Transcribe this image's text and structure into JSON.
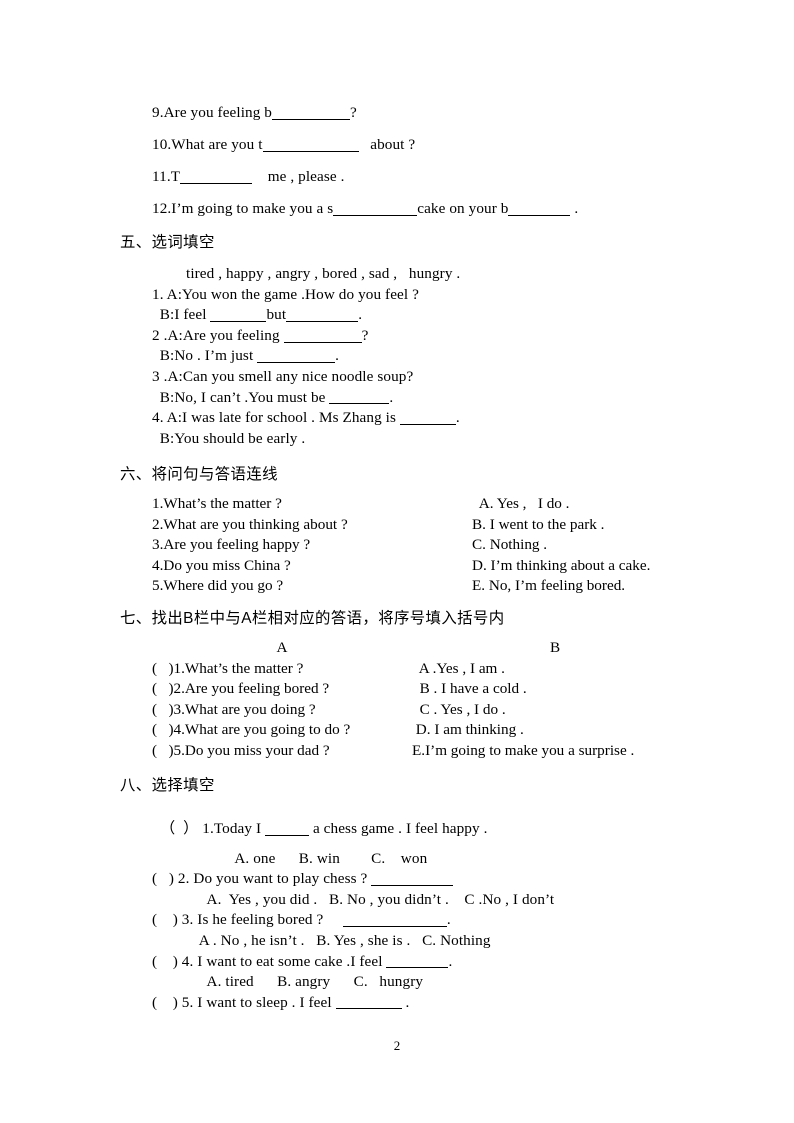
{
  "document": {
    "page_number": "2",
    "language": "English exercise worksheet (Chinese instructions)"
  },
  "fill_in_letters": {
    "items": [
      {
        "num": "9.",
        "before": "Are you feeling b",
        "blank_w": 78,
        "after": "?"
      },
      {
        "num": "10.",
        "before": "What are you t",
        "blank_w": 96,
        "after": "   about ?"
      },
      {
        "num": "11.",
        "before": "T",
        "blank_w": 72,
        "after": "    me , please ."
      },
      {
        "num": "12.",
        "before": "I’m going to make you a s",
        "blank_w": 84,
        "mid": "cake on your b",
        "blank2_w": 62,
        "after": " ."
      }
    ]
  },
  "section5": {
    "heading": "五、选词填空",
    "wordbank": "tired , happy , angry , bored , sad ,   hungry .",
    "items": [
      {
        "q": "1. A:You won the game .How do you feel ?"
      },
      {
        "a_pre": "  B:I feel ",
        "blank_w": 56,
        "a_mid": "but",
        "blank2_w": 72,
        "a_post": "."
      },
      {
        "q": "2 .A:Are you feeling ",
        "blank_w": 78,
        "q_post": "?"
      },
      {
        "a_pre": "  B:No . I’m just ",
        "blank_w": 78,
        "a_post": "."
      },
      {
        "q": "3 .A:Can you smell any nice noodle soup?"
      },
      {
        "a_pre": "  B:No, I can’t .You must be ",
        "blank_w": 60,
        "a_post": "."
      },
      {
        "q": "4. A:I was late for school . Ms Zhang is ",
        "blank_w": 56,
        "q_post": "."
      },
      {
        "a_pre": "  B:You should be early ."
      }
    ]
  },
  "section6": {
    "heading": "六、将问句与答语连线",
    "rows": [
      {
        "left": "1.What’s the matter ?",
        "right": "  A. Yes ,   I do ."
      },
      {
        "left": "2.What are you thinking about ?",
        "right": "B. I went to the park ."
      },
      {
        "left": "3.Are you feeling happy ?",
        "right": "C. Nothing ."
      },
      {
        "left": "4.Do you miss China ?",
        "right": "D. I’m thinking about a cake."
      },
      {
        "left": "5.Where did you go ?",
        "right": "E. No, I’m feeling bored."
      }
    ]
  },
  "section7": {
    "heading": "七、找出B栏中与A栏相对应的答语，将序号填入括号内",
    "col_a_header": "A",
    "col_b_header": "B",
    "rows": [
      {
        "left": "(   )1.What’s the matter ?",
        "right": "  A .Yes , I am ."
      },
      {
        "left": "(   )2.Are you feeling bored ?",
        "right": "  B . I have a cold ."
      },
      {
        "left": "(   )3.What are you doing ?",
        "right": "  C . Yes , I do ."
      },
      {
        "left": "(   )4.What are you going to do ?",
        "right": " D. I am thinking ."
      },
      {
        "left": "(   )5.Do you miss your dad ?",
        "right": "E.I’m going to make you a surprise ."
      }
    ]
  },
  "section8": {
    "heading": "八、选择填空",
    "questions": [
      {
        "stem_pre": "（  ） 1.Today I ",
        "blank_w": 44,
        "stem_post": " a chess game . I feel happy .",
        "options": "        A. one      B. win        C.    won",
        "options_indent": 204
      },
      {
        "stem_pre": "(   ) 2. Do you want to play chess ? ",
        "blank_w": 82,
        "stem_post": "",
        "options": "      A.  Yes , you did .   B. No , you didn’t .    C .No , I don’t",
        "options_indent": 184
      },
      {
        "stem_pre": "(    ) 3. Is he feeling bored ?     ",
        "blank_w": 104,
        "stem_post": ".",
        "options": "    A . No , he isn’t .   B. Yes , she is .   C. Nothing",
        "options_indent": 184
      },
      {
        "stem_pre": "(    ) 4. I want to eat some cake .I feel ",
        "blank_w": 62,
        "stem_post": ".",
        "options": "      A. tired      B. angry      C.   hungry",
        "options_indent": 184
      },
      {
        "stem_pre": "(    ) 5. I want to sleep . I feel ",
        "blank_w": 66,
        "stem_post": " .",
        "options": "",
        "options_indent": 184
      }
    ]
  }
}
